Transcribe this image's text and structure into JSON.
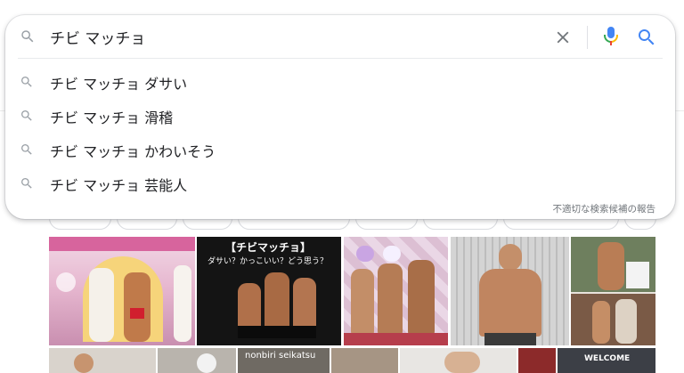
{
  "search": {
    "query": "チビ マッチョ",
    "clear_icon": "close-icon",
    "mic_icon": "microphone-icon",
    "search_icon": "search-icon",
    "colors": {
      "mic_blue": "#4285f4",
      "mic_red": "#ea4335",
      "mic_yellow": "#fbbc05",
      "mic_green": "#34a853",
      "search_blue": "#4285f4",
      "icon_gray": "#9aa0a6"
    }
  },
  "suggestions": [
    {
      "text": "チビ マッチョ ダサい"
    },
    {
      "text": "チビ マッチョ 滑稽"
    },
    {
      "text": "チビ マッチョ かわいそう"
    },
    {
      "text": "チビ マッチョ 芸能人"
    }
  ],
  "report_link": "不適切な検索候補の報告",
  "image_results": {
    "banner_text": "【チビマッチョ】",
    "banner_subtext": "ダサい？かっこいい？どう思う？",
    "logo_text": "nonbiri seikatsu",
    "welcome_text": "WELCOME"
  }
}
